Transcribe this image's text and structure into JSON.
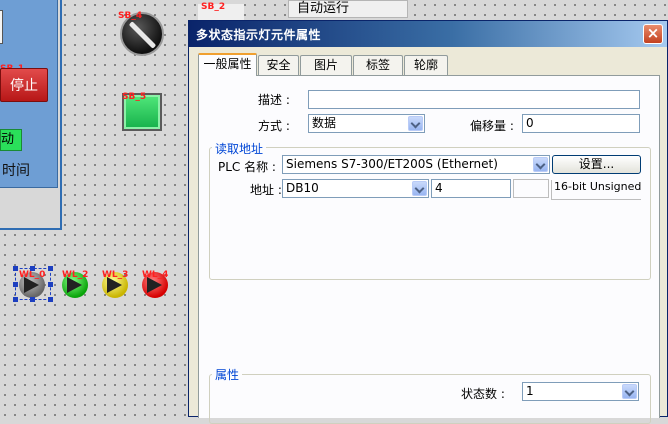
{
  "canvas": {
    "stop_label": "停止",
    "stop_tag": "SB_1",
    "green_label": "动",
    "time_label": "时间",
    "knob_tag": "SB_4",
    "square_tag": "SB_5",
    "sb2_tag": "SB_2",
    "menu_text": "自动运行",
    "lights": [
      "WL_0",
      "WL_2",
      "WL_3",
      "WL_4"
    ]
  },
  "dialog": {
    "title": "多状态指示灯元件属性",
    "close_glyph": "×",
    "tabs": [
      {
        "label": "一般属性",
        "active": true
      },
      {
        "label": "安全",
        "active": false
      },
      {
        "label": "图片",
        "active": false
      },
      {
        "label": "标签",
        "active": false
      },
      {
        "label": "轮廓",
        "active": false
      }
    ],
    "description": {
      "label": "描述 :",
      "value": ""
    },
    "mode": {
      "label": "方式 :",
      "value": "数据"
    },
    "offset": {
      "label": "偏移量 :",
      "value": "0"
    },
    "read_address": {
      "title": "读取地址",
      "plc_name_label": "PLC 名称 :",
      "plc_name_value": "Siemens S7-300/ET200S (Ethernet)",
      "settings_button": "设置...",
      "address_label": "地址 :",
      "address_type": "DB10",
      "address_value": "4",
      "data_format": "16-bit Unsigned"
    },
    "attributes": {
      "title": "属性",
      "state_count_label": "状态数 :",
      "state_count_value": "1"
    }
  }
}
